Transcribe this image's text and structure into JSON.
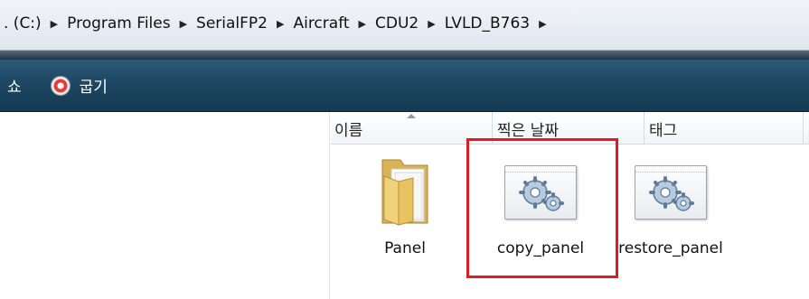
{
  "address_bar": {
    "path": [
      ". (C:)",
      "Program Files",
      "SerialFP2",
      "Aircraft",
      "CDU2",
      "LVLD_B763"
    ],
    "separator": "▶"
  },
  "command_bar": {
    "items": [
      {
        "label": "쇼",
        "icon": ""
      },
      {
        "label": "굽기",
        "icon": "burn-disc-icon"
      }
    ]
  },
  "columns": [
    "이름",
    "찍은 날짜",
    "태그"
  ],
  "sort": {
    "column": "이름",
    "direction": "ascending"
  },
  "files": [
    {
      "name": "Panel",
      "type": "folder",
      "icon": "folder-icon"
    },
    {
      "name": "copy_panel",
      "type": "config",
      "icon": "gears-config-icon",
      "highlighted": true
    },
    {
      "name": "restore_panel",
      "type": "config",
      "icon": "gears-config-icon"
    }
  ],
  "colors": {
    "command_bar": "#1d4763",
    "highlight": "#e01b22"
  }
}
